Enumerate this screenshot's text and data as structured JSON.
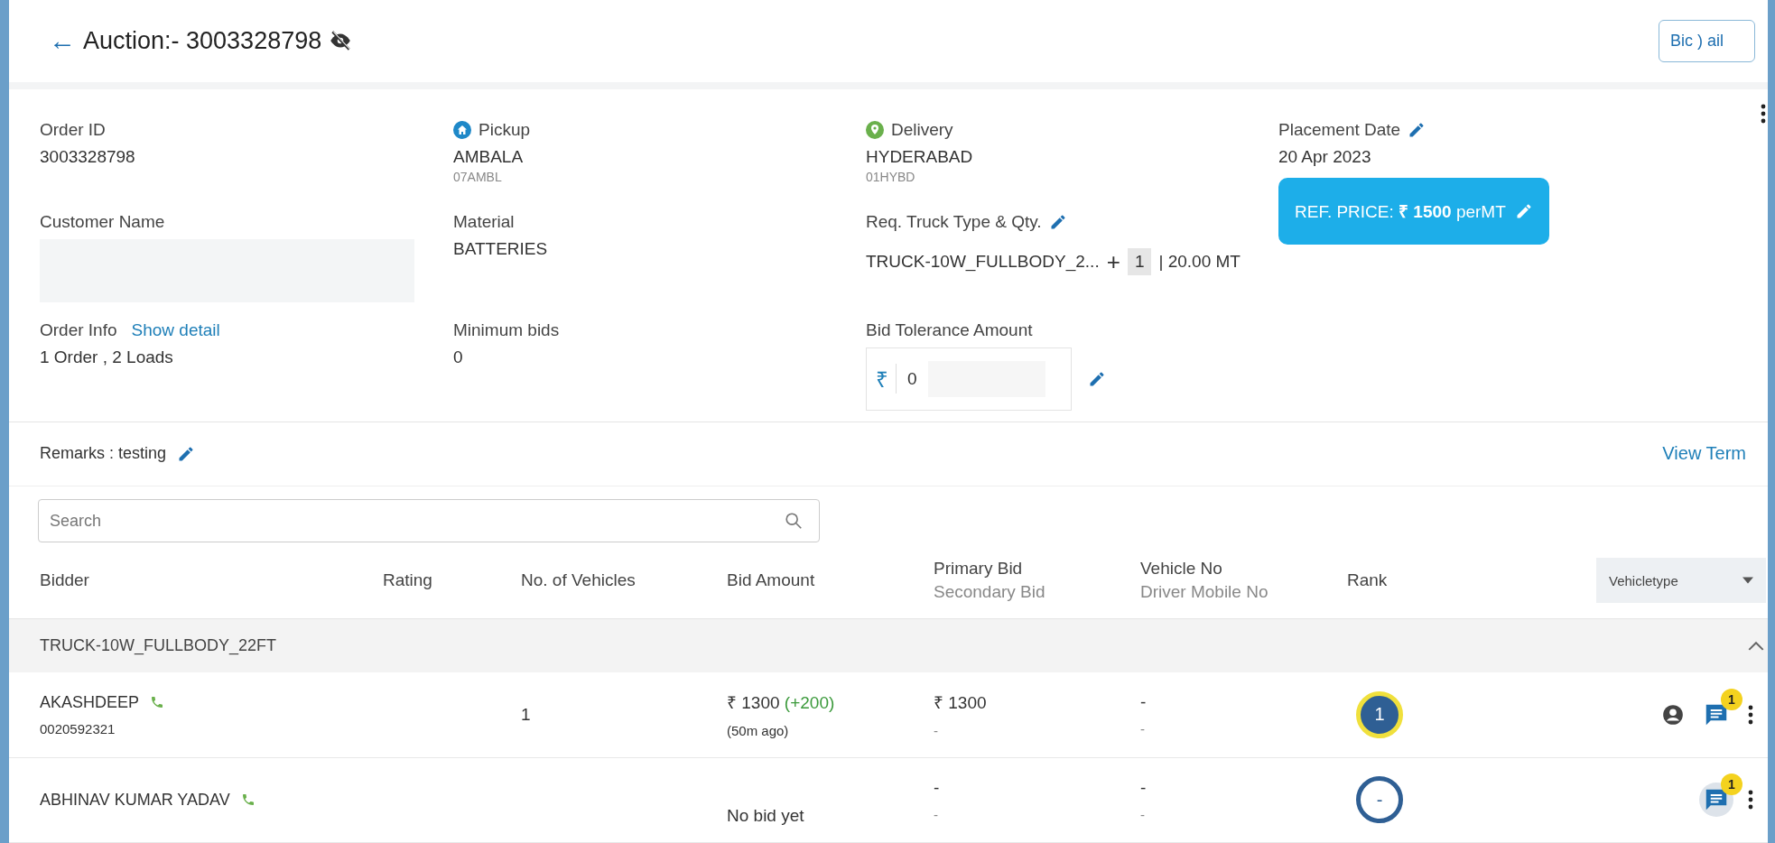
{
  "header": {
    "back": "←",
    "title": "Auction:- 3003328798",
    "button": "Bic ) ail"
  },
  "info": [
    {
      "label": "Order ID",
      "value": "3003328798"
    },
    {
      "label": "Pickup",
      "value": "AMBALA",
      "sub": "07AMBL"
    },
    {
      "label": "Delivery",
      "value": "HYDERABAD",
      "sub": "01HYBD"
    },
    {
      "label": "Placement Date",
      "value": "20 Apr 2023",
      "editable": true
    },
    {
      "label": "Customer Name",
      "value_blurred": true
    },
    {
      "label": "Material",
      "value": "BATTERIES"
    },
    {
      "label": "Req. Truck Type & Qty.",
      "editable": true,
      "truck": "TRUCK-10W_FULLBODY_2...",
      "plus": "+",
      "qty": "1",
      "weight": "| 20.00 MT"
    },
    {
      "label": "REF. PRICE: **₹ 1500** perMT",
      "kind": "price"
    },
    {
      "label": "Order Info",
      "link": "Show detail",
      "value": "1 Order , 2 Loads"
    },
    {
      "label": "Minimum bids",
      "value": "0"
    },
    {
      "label": "Bid Tolerance Amount",
      "currency": "₹",
      "input": "0"
    }
  ],
  "remarks": {
    "text": "Remarks : testing",
    "link": "View Term"
  },
  "search": {
    "placeholder": "Search"
  },
  "table": {
    "columns": [
      "Bidder",
      "Rating",
      "No. of Vehicles",
      "Bid Amount",
      [
        "Primary Bid",
        "Secondary Bid"
      ],
      [
        "Vehicle No",
        "Driver Mobile No"
      ],
      "Rank"
    ],
    "filter": "Vehicletype",
    "group": "TRUCK-10W_FULLBODY_22FT",
    "expanded": true,
    "rows": [
      {
        "bidder": "AKASHDEEP",
        "phone": "0020592321",
        "vehicles": "1",
        "amount": "₹ 1300",
        "change": "(+200)",
        "ago": "(50m ago)",
        "primary": "₹ 1300",
        "secondary": "-",
        "vehicle_no": "-",
        "driver": "-",
        "rank": "1",
        "top_rank": true,
        "profile": true,
        "messages": "1"
      },
      {
        "bidder": "ABHINAV KUMAR YADAV",
        "no_bid": "No bid yet",
        "primary": "-",
        "secondary": "-",
        "vehicle_no": "-",
        "driver": "-",
        "rank": "-",
        "top_rank": false,
        "profile": false,
        "messages": "1"
      }
    ]
  }
}
